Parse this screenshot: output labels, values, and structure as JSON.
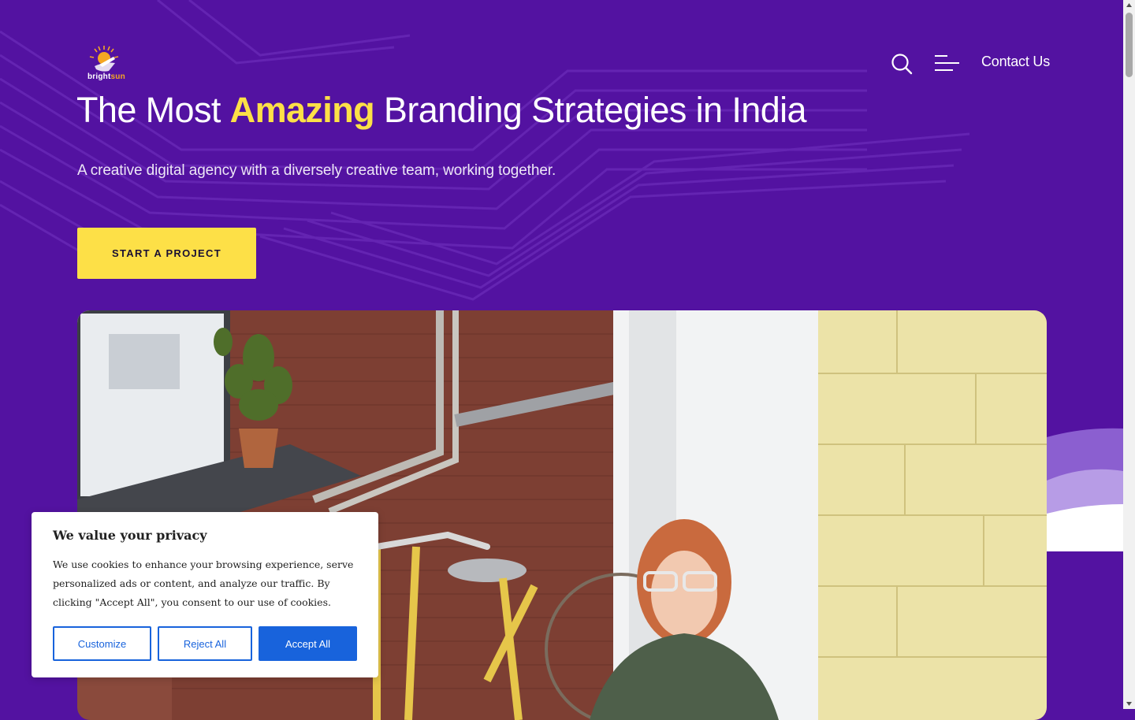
{
  "brand": {
    "logo_icon": "sun-with-open-hand-logo",
    "name_part_1": "bright",
    "name_part_2": "sun"
  },
  "nav": {
    "search_icon": "search-icon",
    "menu_icon": "hamburger-menu-icon",
    "contact_label": "Contact Us"
  },
  "hero": {
    "title_before": "The Most ",
    "title_highlight": "Amazing",
    "title_after": " Branding Strategies in India",
    "subtitle": "A creative digital agency with a diversely creative team, working together.",
    "cta_label": "START A PROJECT",
    "image_description_icon": "office-photo-woman-with-bicycles"
  },
  "cookie_banner": {
    "title": "We value your privacy",
    "body": "We use cookies to enhance your browsing experience, serve personalized ads or content, and analyze our traffic. By clicking \"Accept All\", you consent to our use of cookies.",
    "customize_label": "Customize",
    "reject_label": "Reject All",
    "accept_label": "Accept All"
  },
  "colors": {
    "background": "#5312a1",
    "accent_yellow": "#fde047",
    "cookie_button_blue": "#1863dc"
  }
}
